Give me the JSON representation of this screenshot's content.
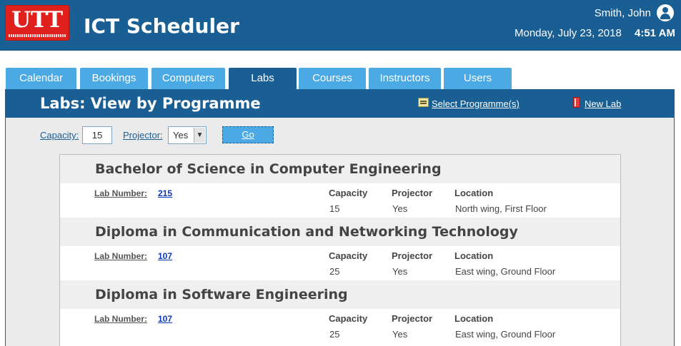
{
  "header": {
    "logo_text": "UTT",
    "app_title": "ICT Scheduler",
    "user_name": "Smith, John",
    "date": "Monday, July 23, 2018",
    "time": "4:51 AM"
  },
  "tabs": [
    {
      "label": "Calendar"
    },
    {
      "label": "Bookings"
    },
    {
      "label": "Computers"
    },
    {
      "label": "Labs",
      "active": true
    },
    {
      "label": "Courses"
    },
    {
      "label": "Instructors"
    },
    {
      "label": "Users"
    }
  ],
  "panel": {
    "title": "Labs: View by Programme",
    "select_programmes_label": "Select Programme(s)",
    "new_lab_label": "New Lab"
  },
  "filter": {
    "capacity_label": "Capacity:",
    "capacity_value": "15",
    "projector_label": "Projector:",
    "projector_value": "Yes",
    "go_label": "Go"
  },
  "columns": {
    "lab_number": "Lab Number:",
    "capacity": "Capacity",
    "projector": "Projector",
    "location": "Location"
  },
  "programmes": [
    {
      "name": "Bachelor of Science in Computer Engineering",
      "lab": {
        "number": "215",
        "capacity": "15",
        "projector": "Yes",
        "location": "North wing, First Floor"
      }
    },
    {
      "name": "Diploma in Communication and Networking Technology",
      "lab": {
        "number": "107",
        "capacity": "25",
        "projector": "Yes",
        "location": "East wing, Ground Floor"
      }
    },
    {
      "name": "Diploma in Software Engineering",
      "lab": {
        "number": "107",
        "capacity": "25",
        "projector": "Yes",
        "location": "East wing, Ground Floor"
      }
    }
  ],
  "colors": {
    "header_bg": "#1a5f93",
    "tab_bg": "#4ba9e3",
    "logo_red": "#e0201c",
    "link_blue": "#0c37b8"
  }
}
